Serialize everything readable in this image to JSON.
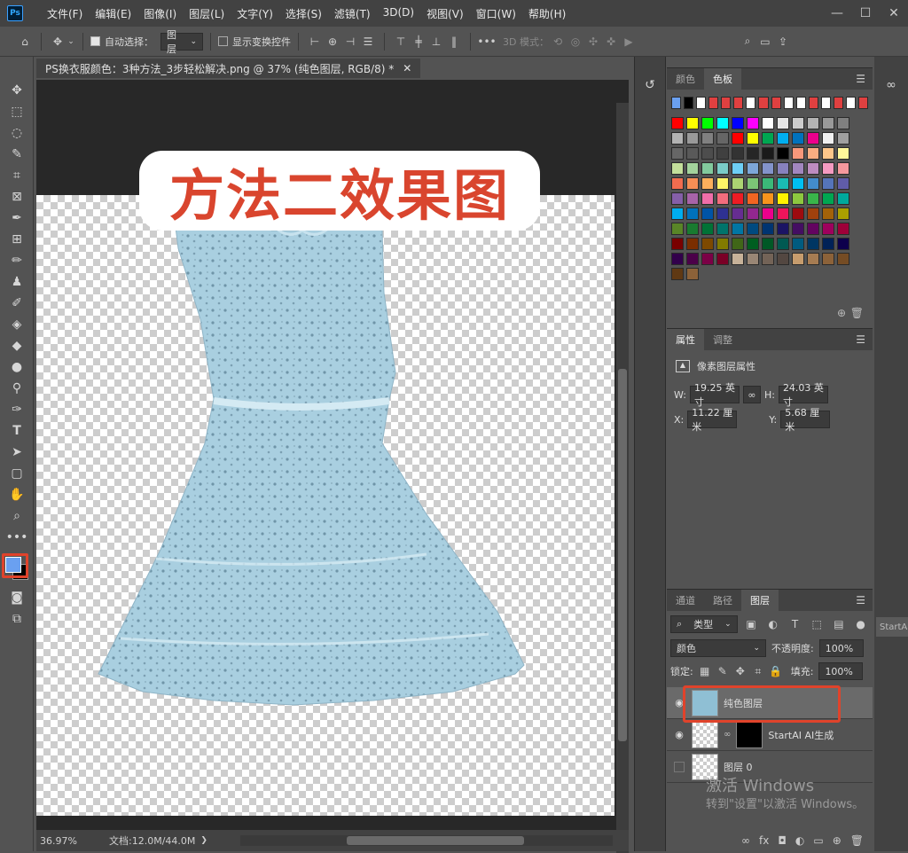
{
  "app": {
    "logo": "Ps"
  },
  "menu": [
    "文件(F)",
    "编辑(E)",
    "图像(I)",
    "图层(L)",
    "文字(Y)",
    "选择(S)",
    "滤镜(T)",
    "3D(D)",
    "视图(V)",
    "窗口(W)",
    "帮助(H)"
  ],
  "window_controls": {
    "minimize": "—",
    "maximize": "☐",
    "close": "✕"
  },
  "options": {
    "auto_select_label": "自动选择：",
    "auto_select_value": "图层",
    "show_transform_label": "显示变换控件",
    "mode_3d_label": "3D 模式："
  },
  "document": {
    "tab_title": "PS换衣服颜色：3种方法_3步轻松解决.png @ 37% (纯色图层, RGB/8) *",
    "tab_close": "✕",
    "banner_text": "方法二效果图"
  },
  "status": {
    "zoom": "36.97%",
    "doc_size": "文档:12.0M/44.0M"
  },
  "swatches_panel": {
    "tabs": [
      "颜色",
      "色板"
    ],
    "active_tab": "色板",
    "recent": [
      "#6aa0f0",
      "#000000",
      "#ffffff",
      "#e04040",
      "#e04040",
      "#e04040",
      "#ffffff",
      "#e04040",
      "#e04040",
      "#ffffff",
      "#ffffff",
      "#e04040",
      "#ffffff",
      "#e04040",
      "#ffffff",
      "#e04040"
    ],
    "rows": [
      [
        "#ff0000",
        "#ffff00",
        "#00ff00",
        "#00ffff",
        "#0000ff",
        "#ff00ff",
        "#ffffff",
        "#e6e6e6",
        "#cccccc",
        "#b3b3b3",
        "#999999",
        "#808080"
      ],
      [
        "#b3b3b3",
        "#999999",
        "#808080",
        "#666666",
        "#ff0000",
        "#ffff00",
        "#00a651",
        "#00aeef",
        "#0072bc",
        "#ec008c",
        "#f0f0f0",
        "#a0a0a0"
      ],
      [
        "#666666",
        "#595959",
        "#4d4d4d",
        "#404040",
        "#333333",
        "#262626",
        "#1a1a1a",
        "#000000",
        "#f7977a",
        "#f9ad81",
        "#fdc68a",
        "#fff79a"
      ],
      [
        "#c4df9b",
        "#a3d39c",
        "#82ca9d",
        "#7accc8",
        "#6dcff6",
        "#7da7d9",
        "#8393ca",
        "#8781bd",
        "#a186be",
        "#bd8cbf",
        "#f49ac1",
        "#f5989d"
      ],
      [
        "#f26c4f",
        "#f68e55",
        "#fbaf5c",
        "#fff467",
        "#acd372",
        "#7cc576",
        "#3bb878",
        "#1abbb4",
        "#00bff3",
        "#438ccb",
        "#5574b9",
        "#605ca8"
      ],
      [
        "#855fa8",
        "#a763a8",
        "#f06ea9",
        "#f26d7d",
        "#ed1c24",
        "#f26522",
        "#f7941d",
        "#fff200",
        "#8dc73f",
        "#39b54a",
        "#00a651",
        "#00a99d"
      ],
      [
        "#00aeef",
        "#0072bc",
        "#0054a6",
        "#2e3192",
        "#662d91",
        "#92278f",
        "#ec008c",
        "#ed145b",
        "#9e0b0f",
        "#a0410d",
        "#a36209",
        "#aba000"
      ],
      [
        "#598527",
        "#197b30",
        "#007236",
        "#00746b",
        "#0076a3",
        "#004a80",
        "#003471",
        "#1b1464",
        "#440e62",
        "#630460",
        "#9e005d",
        "#9e0039"
      ],
      [
        "#790000",
        "#7b2e00",
        "#7d4900",
        "#827b00",
        "#406618",
        "#005e20",
        "#005826",
        "#005952",
        "#005b7f",
        "#003663",
        "#002157",
        "#0d004c"
      ],
      [
        "#32004b",
        "#4b0049",
        "#7b0046",
        "#7a0026",
        "#c7b299",
        "#998675",
        "#736357",
        "#534741",
        "#c69c6d",
        "#a67c52",
        "#8c6239",
        "#754c24"
      ],
      [
        "#603913",
        "#8c6239"
      ]
    ]
  },
  "properties_panel": {
    "tabs": [
      "属性",
      "调整"
    ],
    "active_tab": "属性",
    "header": "像素图层属性",
    "w_label": "W:",
    "w_value": "19.25 英寸",
    "h_label": "H:",
    "h_value": "24.03 英寸",
    "x_label": "X:",
    "x_value": "11.22 厘米",
    "y_label": "Y:",
    "y_value": "5.68 厘米"
  },
  "layers_panel": {
    "tabs": [
      "通道",
      "路径",
      "图层"
    ],
    "active_tab": "图层",
    "filter_label": "类型",
    "blend_mode": "颜色",
    "opacity_label": "不透明度:",
    "opacity_value": "100%",
    "lock_label": "锁定:",
    "fill_label": "填充:",
    "fill_value": "100%",
    "layers": [
      {
        "name": "纯色图层",
        "visible": true,
        "selected": true
      },
      {
        "name": "StartAI AI生成",
        "visible": true,
        "selected": false
      },
      {
        "name": "图层 0",
        "visible": false,
        "selected": false
      }
    ]
  },
  "watermark": {
    "line1": "激活 Windows",
    "line2": "转到\"设置\"以激活 Windows。"
  },
  "side_tooltip": "StartA"
}
